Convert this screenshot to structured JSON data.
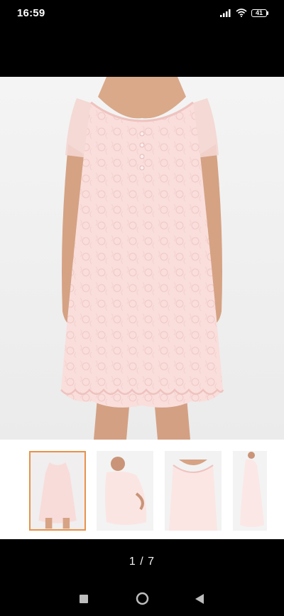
{
  "status_bar": {
    "time": "16:59",
    "battery_level": "41",
    "icons": [
      "signal-icon",
      "wifi-icon",
      "battery-icon"
    ]
  },
  "gallery": {
    "main_image": "pink-lace-dress-front-photo",
    "thumbnails": [
      {
        "image": "dress-front-thumbnail",
        "selected": true
      },
      {
        "image": "dress-side-maternity-thumbnail",
        "selected": false
      },
      {
        "image": "dress-detail-thumbnail",
        "selected": false
      },
      {
        "image": "dress-side-thumbnail",
        "selected": false
      }
    ],
    "page_indicator": "1 / 7"
  },
  "nav_bar": {
    "icons": [
      "recents-square-icon",
      "home-circle-icon",
      "back-triangle-icon"
    ]
  },
  "colors": {
    "dress_pink": "#f7d8d6",
    "selected_border": "#e8924a",
    "background": "#000000"
  }
}
